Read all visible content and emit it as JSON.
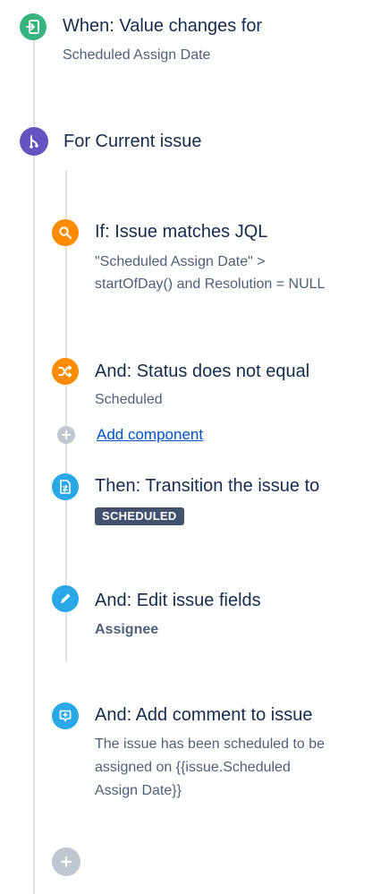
{
  "trigger": {
    "title": "When: Value changes for",
    "subtitle": "Scheduled Assign Date",
    "icon": "trigger-icon",
    "color": "#36b37e"
  },
  "branch": {
    "title": "For Current issue",
    "icon": "branch-icon",
    "color": "#6554c0"
  },
  "components": [
    {
      "title": "If: Issue matches JQL",
      "subtitle_lines": [
        "\"Scheduled Assign Date\" >",
        "startOfDay() and Resolution = NULL"
      ],
      "icon": "search-icon",
      "color": "#ff8b00"
    },
    {
      "title": "And: Status does not equal",
      "subtitle": "Scheduled",
      "icon": "shuffle-icon",
      "color": "#ff8b00"
    },
    {
      "title": "Then: Transition the issue to",
      "badge": "SCHEDULED",
      "icon": "transition-document-icon",
      "color": "#2aa7e6"
    },
    {
      "title": "And: Edit issue fields",
      "subtitle": "Assignee",
      "icon": "pencil-icon",
      "color": "#2aa7e6"
    },
    {
      "title": "And: Add comment to issue",
      "subtitle_lines": [
        "The issue has been scheduled to be",
        "assigned on {{issue.Scheduled",
        "Assign Date}}"
      ],
      "icon": "comment-icon",
      "color": "#2aa7e6"
    }
  ],
  "add_component": {
    "label": "Add component",
    "icon": "plus-icon",
    "color": "#c1c7d0"
  },
  "add_bottom": {
    "icon": "plus-icon",
    "color": "#c1c7d0"
  }
}
